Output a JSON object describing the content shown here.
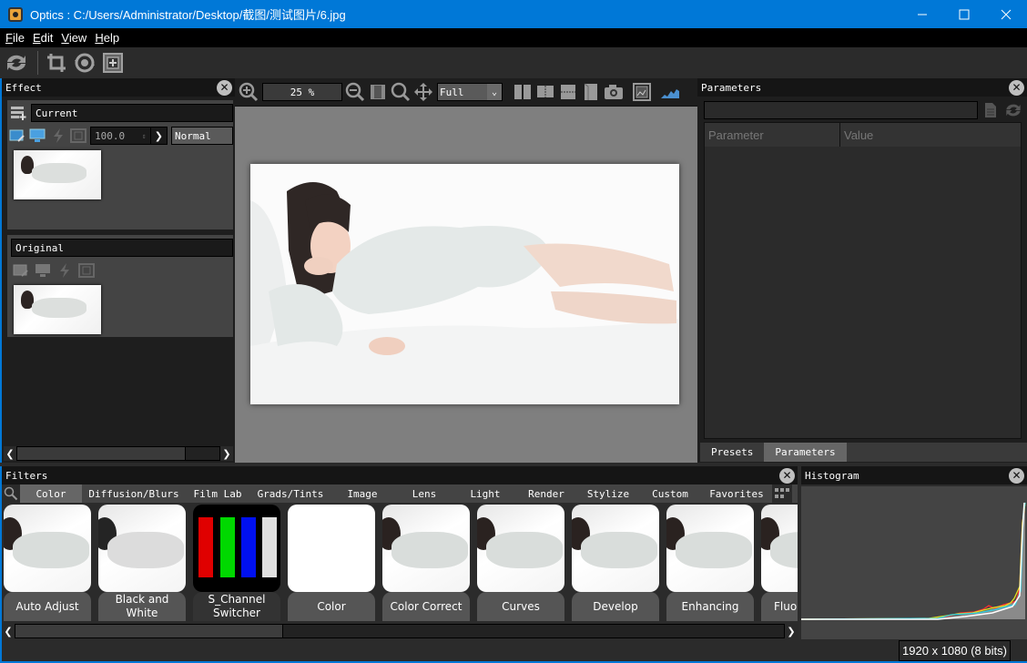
{
  "window": {
    "title": "Optics : C:/Users/Administrator/Desktop/截图/测试图片/6.jpg",
    "controls": {
      "minimize": "—",
      "maximize": "☐",
      "close": "✕"
    }
  },
  "menu": [
    {
      "key": "F",
      "rest": "ile"
    },
    {
      "key": "E",
      "rest": "dit"
    },
    {
      "key": "V",
      "rest": "iew"
    },
    {
      "key": "H",
      "rest": "elp"
    }
  ],
  "main_toolbar": {
    "icons": [
      "refresh-icon",
      "crop-icon",
      "rotate-icon",
      "fit-frame-icon"
    ]
  },
  "effect_panel": {
    "title": "Effect",
    "current_layer": {
      "name": "Current",
      "opacity": "100.0",
      "blend_mode": "Normal"
    },
    "original_layer": {
      "name": "Original"
    }
  },
  "viewer": {
    "zoom_value": "25 %",
    "fit_mode": "Full"
  },
  "parameters_panel": {
    "title": "Parameters",
    "search_value": "",
    "columns": [
      "Parameter",
      "Value"
    ],
    "tabs": [
      {
        "label": "Presets",
        "active": false
      },
      {
        "label": "Parameters",
        "active": true
      }
    ]
  },
  "filters_panel": {
    "title": "Filters",
    "tabs": [
      {
        "label": "Color",
        "active": true
      },
      {
        "label": "Diffusion/Blurs",
        "active": false
      },
      {
        "label": "Film Lab",
        "active": false
      },
      {
        "label": "Grads/Tints",
        "active": false
      },
      {
        "label": "Image",
        "active": false
      },
      {
        "label": "Lens",
        "active": false
      },
      {
        "label": "Light",
        "active": false
      },
      {
        "label": "Render",
        "active": false
      },
      {
        "label": "Stylize",
        "active": false
      },
      {
        "label": "Custom",
        "active": false
      },
      {
        "label": "Favorites",
        "active": false
      }
    ],
    "cards": [
      {
        "label": "Auto Adjust",
        "kind": "photo"
      },
      {
        "label": "Black and White",
        "kind": "bw"
      },
      {
        "label": "S_Channel Switcher",
        "kind": "chan"
      },
      {
        "label": "Color",
        "kind": "white"
      },
      {
        "label": "Color Correct",
        "kind": "photo"
      },
      {
        "label": "Curves",
        "kind": "photo"
      },
      {
        "label": "Develop",
        "kind": "photo"
      },
      {
        "label": "Enhancing",
        "kind": "photo"
      },
      {
        "label": "Fluo",
        "kind": "photo"
      }
    ],
    "channel_colors": [
      "#e00000",
      "#00d800",
      "#0010f0",
      "#e0e0e0"
    ]
  },
  "histogram_panel": {
    "title": "Histogram",
    "image_info": "1920 x 1080 (8 bits)"
  },
  "colors": {
    "accent": "#0078d7",
    "panel_bg": "#2b2b2b",
    "header_bg": "#151515",
    "viewer_bg": "#7f7f7f"
  }
}
